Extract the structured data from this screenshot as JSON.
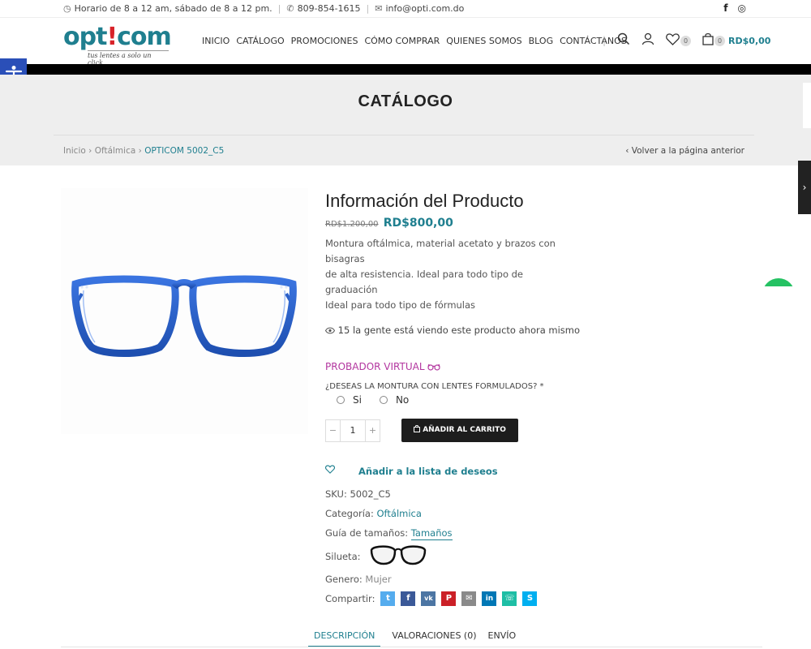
{
  "topbar": {
    "hours": "Horario de 8 a 12 am, sábado de 8 a 12 pm.",
    "phone": "809-854-1615",
    "email": "info@opti.com.do",
    "facebook_glyph": "f",
    "instagram_glyph": "◎"
  },
  "logo": {
    "prefix": "opt",
    "bang": "!",
    "suffix": "com",
    "tagline": "tus lentes a solo un click..."
  },
  "nav": [
    "INICIO",
    "CATÁLOGO",
    "PROMOCIONES",
    "CÓMO COMPRAR",
    "QUIENES SOMOS",
    "BLOG",
    "CONTÁCTANOS"
  ],
  "header_icons": {
    "wishlist_count": "0",
    "cart_count": "0",
    "cart_total": "RD$0,00"
  },
  "page": {
    "title": "CATÁLOGO",
    "breadcrumb": {
      "home": "Inicio",
      "category": "Oftálmica",
      "current": "OPTICOM 5002_C5"
    },
    "back_link": "Volver a la página anterior"
  },
  "product": {
    "title": "Información del Producto",
    "price_old": "RD$1.200,00",
    "price_new": "RD$800,00",
    "description": [
      "Montura oftálmica, material acetato y brazos con bisagras",
      "de alta resistencia. Ideal para todo tipo de graduación",
      "Ideal para todo tipo de fórmulas"
    ],
    "viewers": "15 la gente está viendo este producto ahora mismo",
    "virtual_try": "PROBADOR VIRTUAL",
    "question": "¿DESEAS LA MONTURA CON LENTES FORMULADOS? *",
    "options": [
      "Si",
      "No"
    ],
    "quantity": "1",
    "add_to_cart": "AÑADIR AL CARRITO",
    "wishlist": "Añadir a la lista de deseos",
    "sku_label": "SKU:",
    "sku_value": "5002_C5",
    "category_label": "Categoría:",
    "category_value": "Oftálmica",
    "size_label": "Guía de tamaños:",
    "size_value": "Tamaños",
    "silhouette_label": "Silueta:",
    "gender_label": "Genero:",
    "gender_value": "Mujer",
    "share_label": "Compartir:"
  },
  "share_buttons": [
    {
      "name": "twitter",
      "glyph": "t",
      "color": "#55acee"
    },
    {
      "name": "facebook",
      "glyph": "f",
      "color": "#3b5998"
    },
    {
      "name": "vk",
      "glyph": "vk",
      "color": "#4c75a3"
    },
    {
      "name": "pinterest",
      "glyph": "P",
      "color": "#cb2027"
    },
    {
      "name": "email",
      "glyph": "✉",
      "color": "#8a8a8a"
    },
    {
      "name": "linkedin",
      "glyph": "in",
      "color": "#0077b5"
    },
    {
      "name": "whatsapp",
      "glyph": "☏",
      "color": "#1ebea5"
    },
    {
      "name": "skype",
      "glyph": "S",
      "color": "#00aff0"
    }
  ],
  "tabs": [
    "DESCRIPCIÓN",
    "VALORACIONES (0)",
    "ENVÍO"
  ],
  "colors": {
    "accent": "#1f7f8f",
    "frame_blue": "#2a5fc8",
    "try_on": "#b3369f",
    "a11y_blue": "#2a4fb8"
  },
  "icons": [
    "clock-icon",
    "phone-icon",
    "mail-icon",
    "facebook-icon",
    "instagram-icon",
    "search-icon",
    "user-icon",
    "heart-icon",
    "bag-icon",
    "accessibility-icon",
    "eye-icon",
    "glasses-icon",
    "chevron-right-icon"
  ]
}
